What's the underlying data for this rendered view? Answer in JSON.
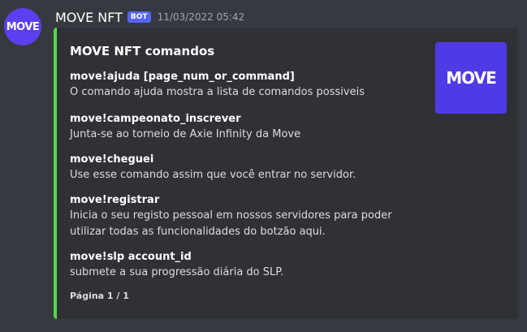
{
  "message": {
    "avatar_text": "MOVE",
    "username": "MOVE NFT",
    "badge": "BOT",
    "timestamp": "11/03/2022 05:42"
  },
  "embed": {
    "accent_color": "#57d647",
    "title": "MOVE NFT comandos",
    "thumbnail_text": "MOVE",
    "fields": [
      {
        "name": "move!ajuda [page_num_or_command]",
        "value": "O comando ajuda mostra a lista de comandos possiveis"
      },
      {
        "name": "move!campeonato_inscrever",
        "value": "Junta-se ao torneio de Axie Infinity da Move"
      },
      {
        "name": "move!cheguei",
        "value": "Use esse comando assim que você entrar no servidor."
      },
      {
        "name": "move!registrar",
        "value_lines": [
          "Inicia o seu registo pessoal em nossos servidores para poder",
          "utilizar todas as funcionalidades do botzão aqui."
        ]
      },
      {
        "name": "move!slp account_id",
        "value": "submete a sua progressão diária do SLP."
      }
    ],
    "footer": "Página 1 / 1"
  }
}
